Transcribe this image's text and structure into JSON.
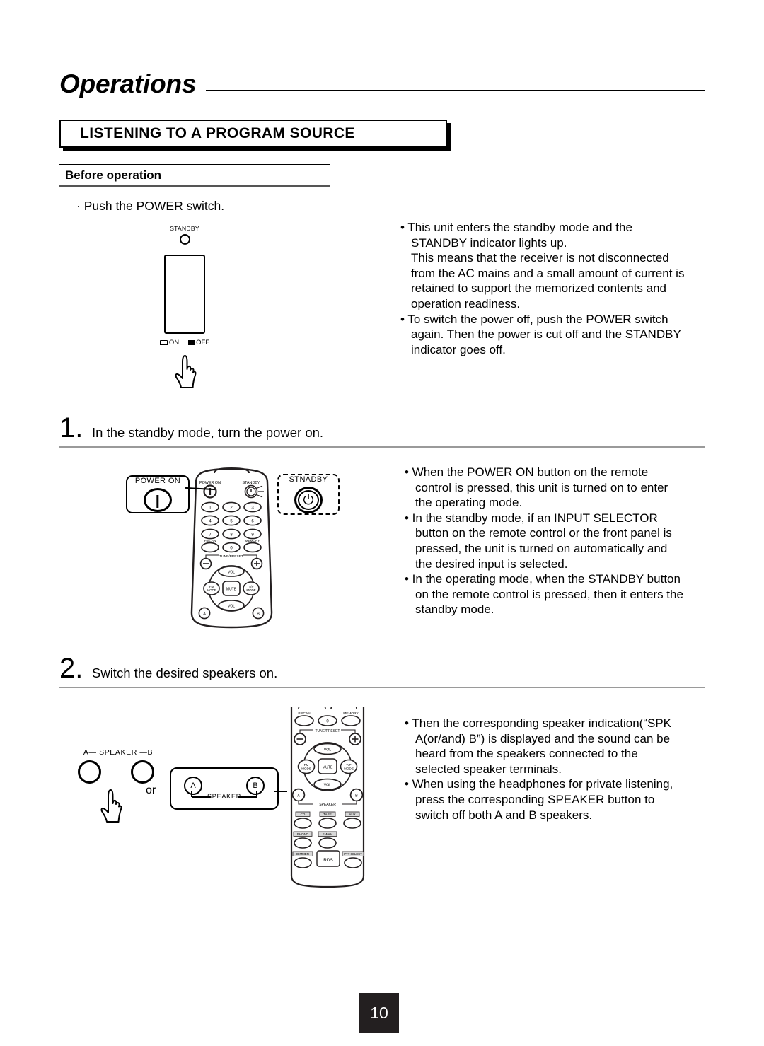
{
  "page": {
    "title": "Operations",
    "section_heading": "LISTENING TO A PROGRAM SOURCE",
    "subheading": "Before operation",
    "page_number": "10"
  },
  "before_operation": {
    "lead": "· Push the POWER switch.",
    "notes": [
      "• This unit enters the standby mode and the",
      "STANDBY indicator lights up.",
      "This means that the receiver is not disconnected",
      "from the AC mains and a small amount of current is",
      "retained to support the memorized contents and",
      "operation readiness.",
      "• To switch the power off, push the POWER switch",
      "again. Then the power is cut off and the STANDBY",
      "indicator goes off."
    ]
  },
  "power_switch_figure": {
    "standby_label": "STANDBY",
    "on_label": "ON",
    "off_label": "OFF"
  },
  "steps": [
    {
      "number": "1.",
      "title": "In the standby mode, turn the power on.",
      "notes": [
        "• When the POWER ON button on the remote",
        "control is pressed, this unit is turned on to enter",
        "the operating mode.",
        "• In the standby mode, if an INPUT SELECTOR",
        "button on the remote control or the front panel is",
        "pressed, the unit is turned on automatically and",
        "the desired input is selected.",
        "• In the operating mode, when the STANDBY button",
        "on the remote control is pressed, then it enters the",
        "standby mode."
      ]
    },
    {
      "number": "2.",
      "title": "Switch the desired speakers on.",
      "notes": [
        "• Then the corresponding speaker indication(“SPK",
        "A(or/and) B”) is displayed and the sound can be",
        "heard from the speakers connected to the",
        "selected speaker terminals.",
        "• When using the headphones for private listening,",
        "press the corresponding SPEAKER button to",
        "switch off both A and B speakers."
      ]
    }
  ],
  "remote_top": {
    "callout_power_on": "POWER ON",
    "callout_standby": "STNADBY",
    "label_power_on": "POWER ON",
    "label_standby": "STANDBY",
    "keys": [
      "1",
      "2",
      "3",
      "4",
      "5",
      "6",
      "7",
      "8",
      "9"
    ],
    "key_pscan": "P.SCAN",
    "key_zero": "0",
    "key_memory": "MEMORY",
    "label_tune_preset": "TUNE/PRESET",
    "key_minus": "−",
    "key_plus": "+",
    "key_vol_up": "VOL",
    "key_vol_down": "VOL",
    "key_fm_mode": "FM MODE",
    "key_mute": "MUTE",
    "key_tp_mode": "T/P MODE",
    "key_a": "A",
    "key_b": "B"
  },
  "remote_bottom": {
    "key_pscan": "P.SCAN",
    "key_zero": "0",
    "key_memory": "MEMORY",
    "label_tune_preset": "TUNE/PRESET",
    "key_minus": "−",
    "key_plus": "+",
    "key_vol_up": "VOL",
    "key_vol_down": "VOL",
    "key_fm_mode": "FM MODE",
    "key_mute": "MUTE",
    "key_tp_mode": "T/P MODE",
    "key_a": "A",
    "key_b": "B",
    "label_speaker": "SPEAKER",
    "key_cd": "CD",
    "key_tape": "TAPE",
    "key_aux": "AUX",
    "key_phono": "PHONO",
    "key_fmam": "FM/AM",
    "key_dimmer": "DIMMER",
    "key_rds": "RDS",
    "key_pty": "PTY SELECT"
  },
  "speaker_figure": {
    "label": "A— SPEAKER —B",
    "or": "or",
    "callout_a": "A",
    "callout_b": "B",
    "callout_label": "SPEAKER"
  }
}
